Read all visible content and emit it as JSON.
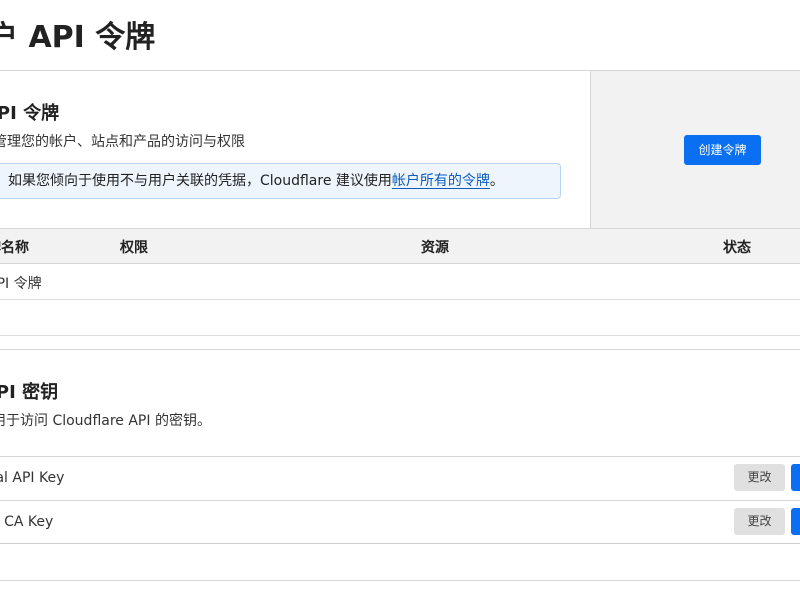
{
  "page": {
    "title": "户 API 令牌"
  },
  "api_tokens": {
    "title": "API 令牌",
    "description": "管理您的帐户、站点和产品的访问与权限",
    "info_text": "如果您倾向于使用不与用户关联的凭据，Cloudflare 建议使用",
    "info_link": "帐户所有的令牌",
    "info_suffix": "。",
    "create_button": "创建令牌",
    "columns": [
      "牌名称",
      "权限",
      "资源",
      "状态"
    ],
    "rows": [
      {
        "name": "API 令牌"
      }
    ]
  },
  "api_keys": {
    "title": "API 密钥",
    "description": "用于访问 Cloudflare API 的密钥。",
    "keys": [
      {
        "name": "obal API Key",
        "change_label": "更改"
      },
      {
        "name": "gin CA Key",
        "change_label": "更改"
      }
    ]
  },
  "colors": {
    "accent": "#0a6ff0",
    "info_bg": "#eef5fd",
    "info_border": "#b8d3f3",
    "header_bg": "#f2f2f2"
  }
}
